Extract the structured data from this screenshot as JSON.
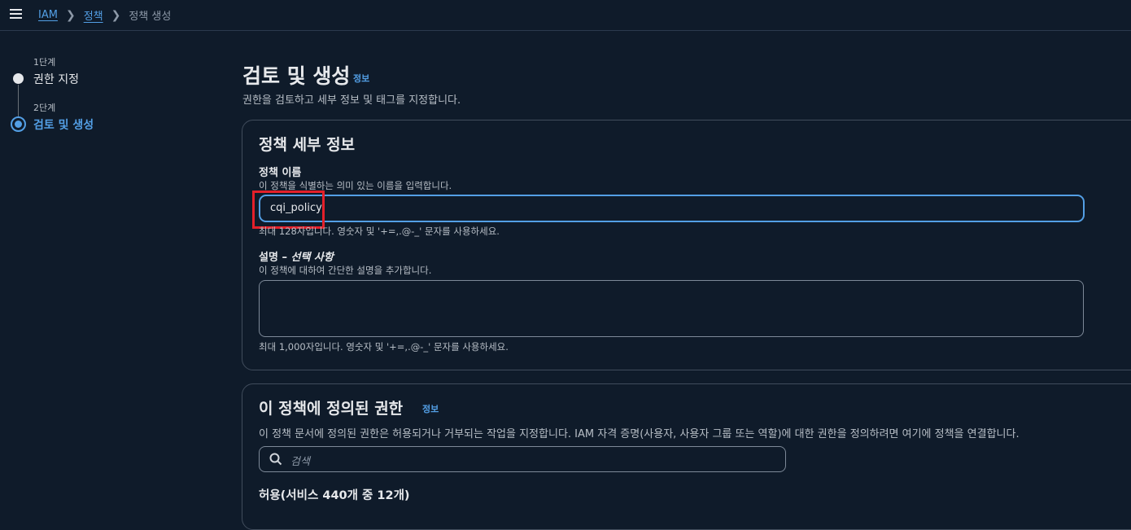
{
  "breadcrumb": {
    "items": [
      "IAM",
      "정책"
    ],
    "current": "정책 생성"
  },
  "steps": [
    {
      "number": "1단계",
      "title": "권한 지정"
    },
    {
      "number": "2단계",
      "title": "검토 및 생성"
    }
  ],
  "page": {
    "title": "검토 및 생성",
    "info_link": "정보",
    "description": "권한을 검토하고 세부 정보 및 태그를 지정합니다."
  },
  "policy_details": {
    "title": "정책 세부 정보",
    "name_label": "정책 이름",
    "name_hint": "이 정책을 식별하는 의미 있는 이름을 입력합니다.",
    "name_value": "cqi_policy",
    "name_constraint": "최대 128자입니다. 영숫자 및 '+=,.@-_' 문자를 사용하세요.",
    "desc_label": "설명 – ",
    "desc_label_optional": "선택 사항",
    "desc_hint": "이 정책에 대하여 간단한 설명을 추가합니다.",
    "desc_value": "",
    "desc_constraint": "최대 1,000자입니다. 영숫자 및 '+=,.@-_' 문자를 사용하세요."
  },
  "permissions": {
    "title": "이 정책에 정의된 권한",
    "info_link": "정보",
    "description": "이 정책 문서에 정의된 권한은 허용되거나 거부되는 작업을 지정합니다. IAM 자격 증명(사용자, 사용자 그룹 또는 역할)에 대한 권한을 정의하려면 여기에 정책을 연결합니다.",
    "search_placeholder": "검색",
    "allow_summary": "허용(서비스 440개 중 12개)"
  },
  "colors": {
    "background": "#0f1b2a",
    "link": "#539fe5",
    "highlight": "#e4202a"
  }
}
